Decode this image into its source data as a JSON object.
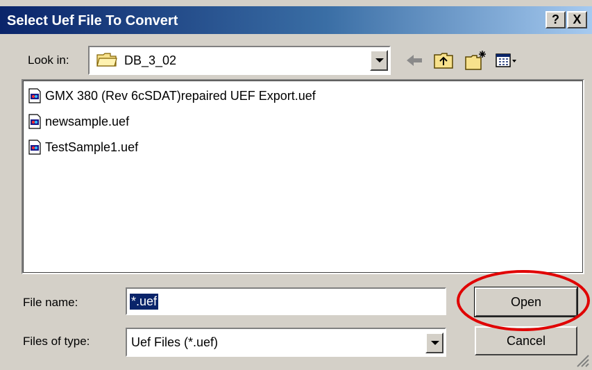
{
  "window": {
    "title": "Select Uef File To Convert",
    "help_label": "?",
    "close_label": "X"
  },
  "lookin": {
    "label": "Look in:",
    "value": "DB_3_02"
  },
  "toolbar": {
    "icons": [
      "back-icon",
      "up-folder-icon",
      "new-folder-icon",
      "view-menu-icon"
    ]
  },
  "files": [
    {
      "name": "GMX 380 (Rev 6cSDAT)repaired UEF Export.uef"
    },
    {
      "name": "newsample.uef"
    },
    {
      "name": "TestSample1.uef"
    }
  ],
  "filename": {
    "label": "File name:",
    "value": "*.uef"
  },
  "filetype": {
    "label": "Files of type:",
    "value": "Uef Files (*.uef)"
  },
  "buttons": {
    "open_label": "Open",
    "cancel_label": "Cancel"
  },
  "colors": {
    "titlebar_start": "#0a246a",
    "titlebar_end": "#a6caf0",
    "dialog_bg": "#d4d0c8",
    "annotation_red": "#e00000"
  }
}
